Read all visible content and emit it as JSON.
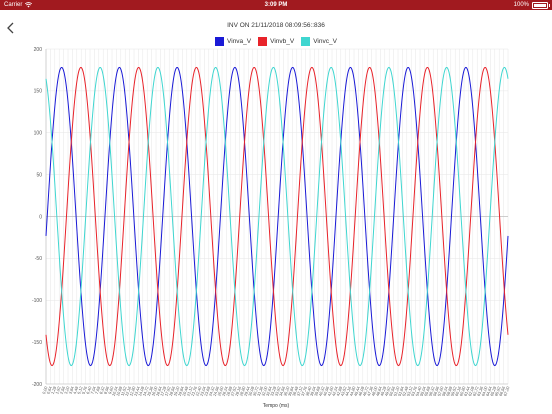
{
  "status_bar": {
    "carrier": "Carrier",
    "time": "3:09 PM",
    "battery": "100%"
  },
  "nav": {
    "back_icon": "chevron-left-icon"
  },
  "chart_data": {
    "type": "line",
    "title": "INV ON 21/11/2018 08:09:56::836",
    "xlabel": "Tempo (ms)",
    "ylabel": "",
    "ylim": [
      -200,
      200
    ],
    "yticks": [
      -200,
      -150,
      -100,
      -50,
      0,
      50,
      100,
      150,
      200
    ],
    "x_tick_labels": [
      "0,00",
      "0,64",
      "1,28",
      "1,92",
      "2,56",
      "3,20",
      "3,84",
      "4,48",
      "5,12",
      "5,76",
      "6,40",
      "7,04",
      "7,68",
      "8,32",
      "8,96",
      "9,60",
      "10,24",
      "10,88",
      "11,52",
      "12,16",
      "12,80",
      "13,44",
      "14,08",
      "14,72",
      "15,36",
      "16,00",
      "16,64",
      "17,28",
      "17,92",
      "18,56",
      "19,20",
      "19,84",
      "20,48",
      "21,12",
      "21,76",
      "22,40",
      "23,04",
      "23,68",
      "24,32",
      "24,96",
      "25,60",
      "26,24",
      "26,88",
      "27,52",
      "28,16",
      "28,80",
      "29,44",
      "30,08",
      "30,72",
      "31,36",
      "32,00",
      "32,64",
      "33,28",
      "33,92",
      "34,56",
      "35,20",
      "35,84",
      "36,48",
      "37,12",
      "37,76",
      "38,40",
      "39,04",
      "39,68",
      "40,32",
      "40,96",
      "41,60",
      "42,24",
      "42,88",
      "43,52",
      "44,16",
      "44,80",
      "45,44",
      "46,08",
      "46,72",
      "47,36",
      "48,00",
      "48,64",
      "49,28",
      "49,92",
      "50,56",
      "51,20",
      "51,84",
      "52,48",
      "53,12",
      "53,76",
      "54,40",
      "55,04",
      "55,68",
      "56,32",
      "56,96",
      "57,60",
      "58,24",
      "58,88",
      "59,52",
      "60,16",
      "60,80",
      "61,44",
      "62,08",
      "62,72",
      "63,36",
      "64,00",
      "64,64",
      "65,28",
      "65,92",
      "66,56",
      "67,20"
    ],
    "x_range_ms": [
      0,
      67.2
    ],
    "grid": true,
    "legend_position": "top",
    "series": [
      {
        "name": "Vinva_V",
        "color": "#1a1ad6",
        "amplitude": 178,
        "period_ms": 8.4,
        "phase_deg": -7.5
      },
      {
        "name": "Vinvb_V",
        "color": "#e8232a",
        "amplitude": 178,
        "period_ms": 8.4,
        "phase_deg": -127.5
      },
      {
        "name": "Vinvc_V",
        "color": "#3fd6d0",
        "amplitude": 178,
        "period_ms": 8.4,
        "phase_deg": 112.5
      }
    ]
  }
}
